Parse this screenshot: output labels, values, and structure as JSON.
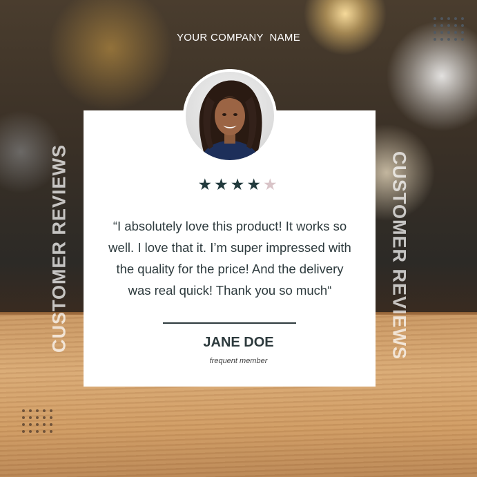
{
  "header": {
    "company_name": "YOUR COMPANY  NAME"
  },
  "side": {
    "left_text": "CUSTOMER REVIEWS",
    "right_text": "CUSTOMER REVIEWS"
  },
  "review": {
    "rating": 4,
    "max_rating": 5,
    "quote": "“I absolutely love this product! It works so well. I love that it. I’m super impressed with the quality for the price! And the delivery was real quick! Thank you so much“",
    "reviewer_name": "JANE DOE",
    "reviewer_role": "frequent member"
  },
  "colors": {
    "dark_teal": "#223a3d",
    "star_inactive": "#d9c4c8",
    "card_bg": "#ffffff"
  },
  "icons": {
    "avatar": "reviewer-portrait",
    "star": "star-icon"
  }
}
